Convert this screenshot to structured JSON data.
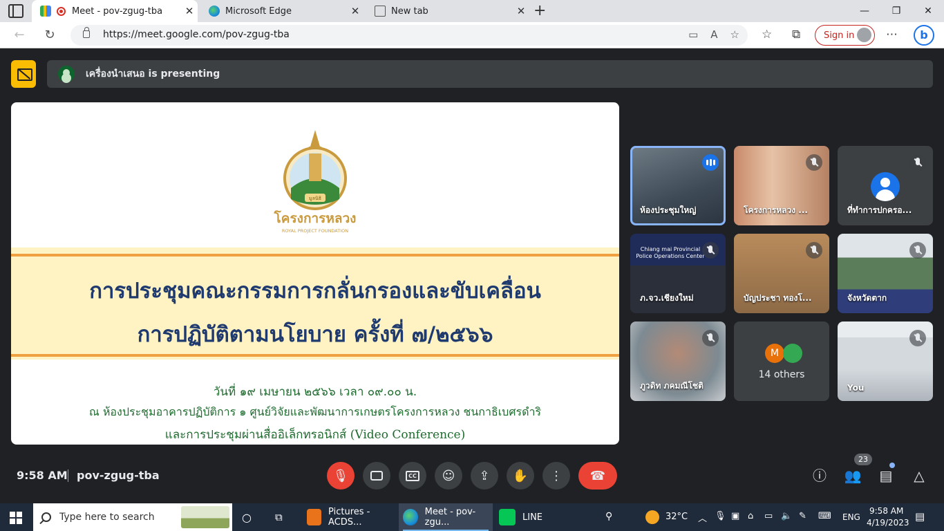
{
  "browser": {
    "tabs": [
      {
        "label": "Meet - pov-zgug-tba",
        "icon": "meet-icon",
        "active": true
      },
      {
        "label": "Microsoft Edge",
        "icon": "edge-icon",
        "active": false
      },
      {
        "label": "New tab",
        "icon": "new-tab-icon",
        "active": false
      }
    ],
    "url": "https://meet.google.com/pov-zgug-tba",
    "signin_label": "Sign in",
    "bing_label": "b"
  },
  "meet": {
    "presenting_text": "เครื่องนำเสนอ is presenting",
    "slide": {
      "title_line1": "การประชุมคณะกรรมการกลั่นกรองและขับเคลื่อน",
      "title_line2": "การปฏิบัติตามนโยบาย ครั้งที่ ๗/๒๕๖๖",
      "date_line": "วันที่ ๑๙ เมษายน ๒๕๖๖ เวลา ๐๙.๐๐ น.",
      "place_line": "ณ ห้องประชุมอาคารปฏิบัติการ ๑ ศูนย์วิจัยและพัฒนาการเกษตรโครงการหลวง ชนกาธิเบศรดำริ",
      "conf_line": "และการประชุมผ่านสื่ออิเล็กทรอนิกส์ (Video Conference)",
      "logo_text": "โครงการหลวง",
      "logo_sub": "ROYAL PROJECT FOUNDATION",
      "logo_badge": "มูลนิธิ"
    },
    "participants": [
      {
        "name": "ห้องประชุมใหญ่",
        "status": "speaking"
      },
      {
        "name": "โครงการหลวง ...",
        "status": "muted"
      },
      {
        "name": "ที่ทำการปกครอ...",
        "status": "muted"
      },
      {
        "name": "ภ.จว.เชียงใหม่",
        "status": "muted",
        "overlay": "Chiang mai Provincial Police Operations Center"
      },
      {
        "name": "บัญประชา ทองโ...",
        "status": "muted"
      },
      {
        "name": "จังหวัดตาก",
        "status": "muted"
      },
      {
        "name": "ภูวดิท ภคมณีโชติ",
        "status": "muted"
      },
      {
        "name": "You",
        "status": "muted"
      }
    ],
    "others": {
      "label": "14 others",
      "avatar_letter": "M"
    },
    "time": "9:58 AM",
    "meeting_code": "pov-zgug-tba",
    "people_count": "23"
  },
  "taskbar": {
    "search_placeholder": "Type here to search",
    "apps": [
      {
        "label": "Pictures - ACDS..."
      },
      {
        "label": "Meet - pov-zgu..."
      },
      {
        "label": "LINE"
      }
    ],
    "temperature": "32°C",
    "language": "ENG",
    "time": "9:58 AM",
    "date": "4/19/2023"
  },
  "colors": {
    "meet_bg": "#202124",
    "leave_red": "#ea4335",
    "presenting_yellow": "#fbbc04",
    "speaking_blue": "#8ab4f8",
    "slide_title": "#1f3a6e",
    "slide_sub": "#1e6b2e"
  }
}
